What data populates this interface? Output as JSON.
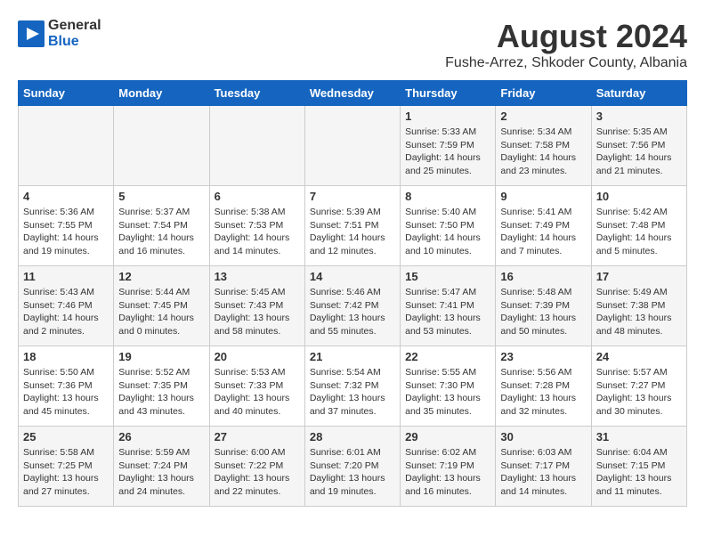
{
  "header": {
    "logo": {
      "general": "General",
      "blue": "Blue",
      "icon": "▶"
    },
    "title": "August 2024",
    "location": "Fushe-Arrez, Shkoder County, Albania"
  },
  "days_of_week": [
    "Sunday",
    "Monday",
    "Tuesday",
    "Wednesday",
    "Thursday",
    "Friday",
    "Saturday"
  ],
  "weeks": [
    [
      {
        "day": "",
        "info": ""
      },
      {
        "day": "",
        "info": ""
      },
      {
        "day": "",
        "info": ""
      },
      {
        "day": "",
        "info": ""
      },
      {
        "day": "1",
        "info": "Sunrise: 5:33 AM\nSunset: 7:59 PM\nDaylight: 14 hours\nand 25 minutes."
      },
      {
        "day": "2",
        "info": "Sunrise: 5:34 AM\nSunset: 7:58 PM\nDaylight: 14 hours\nand 23 minutes."
      },
      {
        "day": "3",
        "info": "Sunrise: 5:35 AM\nSunset: 7:56 PM\nDaylight: 14 hours\nand 21 minutes."
      }
    ],
    [
      {
        "day": "4",
        "info": "Sunrise: 5:36 AM\nSunset: 7:55 PM\nDaylight: 14 hours\nand 19 minutes."
      },
      {
        "day": "5",
        "info": "Sunrise: 5:37 AM\nSunset: 7:54 PM\nDaylight: 14 hours\nand 16 minutes."
      },
      {
        "day": "6",
        "info": "Sunrise: 5:38 AM\nSunset: 7:53 PM\nDaylight: 14 hours\nand 14 minutes."
      },
      {
        "day": "7",
        "info": "Sunrise: 5:39 AM\nSunset: 7:51 PM\nDaylight: 14 hours\nand 12 minutes."
      },
      {
        "day": "8",
        "info": "Sunrise: 5:40 AM\nSunset: 7:50 PM\nDaylight: 14 hours\nand 10 minutes."
      },
      {
        "day": "9",
        "info": "Sunrise: 5:41 AM\nSunset: 7:49 PM\nDaylight: 14 hours\nand 7 minutes."
      },
      {
        "day": "10",
        "info": "Sunrise: 5:42 AM\nSunset: 7:48 PM\nDaylight: 14 hours\nand 5 minutes."
      }
    ],
    [
      {
        "day": "11",
        "info": "Sunrise: 5:43 AM\nSunset: 7:46 PM\nDaylight: 14 hours\nand 2 minutes."
      },
      {
        "day": "12",
        "info": "Sunrise: 5:44 AM\nSunset: 7:45 PM\nDaylight: 14 hours\nand 0 minutes."
      },
      {
        "day": "13",
        "info": "Sunrise: 5:45 AM\nSunset: 7:43 PM\nDaylight: 13 hours\nand 58 minutes."
      },
      {
        "day": "14",
        "info": "Sunrise: 5:46 AM\nSunset: 7:42 PM\nDaylight: 13 hours\nand 55 minutes."
      },
      {
        "day": "15",
        "info": "Sunrise: 5:47 AM\nSunset: 7:41 PM\nDaylight: 13 hours\nand 53 minutes."
      },
      {
        "day": "16",
        "info": "Sunrise: 5:48 AM\nSunset: 7:39 PM\nDaylight: 13 hours\nand 50 minutes."
      },
      {
        "day": "17",
        "info": "Sunrise: 5:49 AM\nSunset: 7:38 PM\nDaylight: 13 hours\nand 48 minutes."
      }
    ],
    [
      {
        "day": "18",
        "info": "Sunrise: 5:50 AM\nSunset: 7:36 PM\nDaylight: 13 hours\nand 45 minutes."
      },
      {
        "day": "19",
        "info": "Sunrise: 5:52 AM\nSunset: 7:35 PM\nDaylight: 13 hours\nand 43 minutes."
      },
      {
        "day": "20",
        "info": "Sunrise: 5:53 AM\nSunset: 7:33 PM\nDaylight: 13 hours\nand 40 minutes."
      },
      {
        "day": "21",
        "info": "Sunrise: 5:54 AM\nSunset: 7:32 PM\nDaylight: 13 hours\nand 37 minutes."
      },
      {
        "day": "22",
        "info": "Sunrise: 5:55 AM\nSunset: 7:30 PM\nDaylight: 13 hours\nand 35 minutes."
      },
      {
        "day": "23",
        "info": "Sunrise: 5:56 AM\nSunset: 7:28 PM\nDaylight: 13 hours\nand 32 minutes."
      },
      {
        "day": "24",
        "info": "Sunrise: 5:57 AM\nSunset: 7:27 PM\nDaylight: 13 hours\nand 30 minutes."
      }
    ],
    [
      {
        "day": "25",
        "info": "Sunrise: 5:58 AM\nSunset: 7:25 PM\nDaylight: 13 hours\nand 27 minutes."
      },
      {
        "day": "26",
        "info": "Sunrise: 5:59 AM\nSunset: 7:24 PM\nDaylight: 13 hours\nand 24 minutes."
      },
      {
        "day": "27",
        "info": "Sunrise: 6:00 AM\nSunset: 7:22 PM\nDaylight: 13 hours\nand 22 minutes."
      },
      {
        "day": "28",
        "info": "Sunrise: 6:01 AM\nSunset: 7:20 PM\nDaylight: 13 hours\nand 19 minutes."
      },
      {
        "day": "29",
        "info": "Sunrise: 6:02 AM\nSunset: 7:19 PM\nDaylight: 13 hours\nand 16 minutes."
      },
      {
        "day": "30",
        "info": "Sunrise: 6:03 AM\nSunset: 7:17 PM\nDaylight: 13 hours\nand 14 minutes."
      },
      {
        "day": "31",
        "info": "Sunrise: 6:04 AM\nSunset: 7:15 PM\nDaylight: 13 hours\nand 11 minutes."
      }
    ]
  ]
}
